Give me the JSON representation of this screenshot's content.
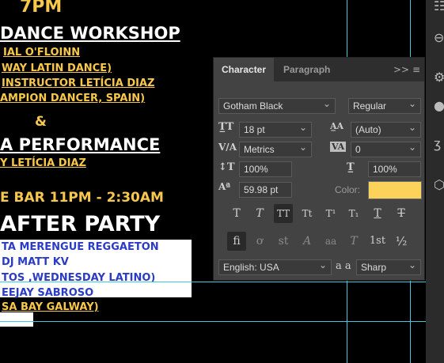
{
  "poster": {
    "time": "7PM",
    "workshop_title": "DANCE WORKSHOP",
    "workshop_line1": "IAL O'FLOINN",
    "workshop_line2": "WAY LATIN DANCE)",
    "workshop_line3": "INSTRUCTOR LETÍCIA DIAZ",
    "workshop_line4": "AMPION DANCER, SPAIN)",
    "amp": "&",
    "performance_title": "A PERFORMANCE",
    "performance_line": "Y LETÍCIA DIAZ",
    "bar_time": "E BAR 11PM - 2:30AM",
    "after_party": "AFTER PARTY",
    "lineup1": "TA MERENGUE REGGAETON",
    "lineup2": "DJ MATT KV",
    "lineup3": "TOS ,WEDNESDAY LATINO)",
    "lineup4": "EEJAY SABROSO",
    "lineup5": "SA BAY GALWAY)"
  },
  "panel": {
    "tab_character": "Character",
    "tab_paragraph": "Paragraph",
    "expand_icon": ">>",
    "menu_icon": "≡",
    "font_family": "Gotham Black",
    "font_style": "Regular",
    "font_size": "18 pt",
    "leading": "(Auto)",
    "kerning": "Metrics",
    "tracking": "0",
    "vertical_scale": "100%",
    "horizontal_scale": "100%",
    "baseline_shift": "59.98 pt",
    "color_label": "Color:",
    "color_value": "#fcd35a",
    "language": "English: USA",
    "aa_icon": "a a",
    "antialias": "Sharp",
    "style_buttons": [
      "T",
      "T",
      "TT",
      "Tt",
      "T¹",
      "T₁",
      "T",
      "T"
    ],
    "opentype_buttons": [
      "fi",
      "ơ",
      "st",
      "A",
      "aa",
      "T",
      "1st",
      "½"
    ]
  }
}
